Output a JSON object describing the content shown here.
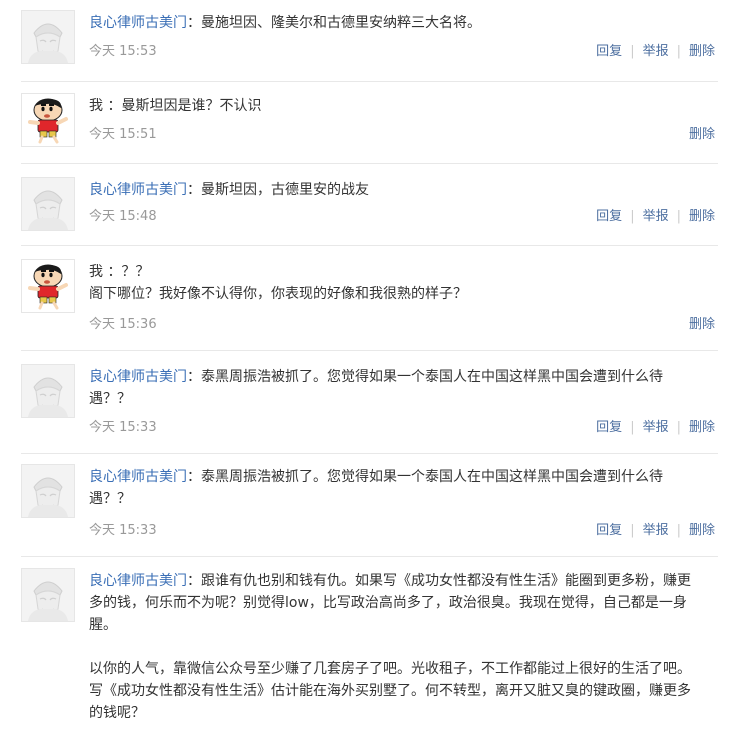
{
  "comments": [
    {
      "author": "良心律师古美门",
      "kind": "lawyer",
      "lines": [
        "：曼施坦因、隆美尔和古德里安纳粹三大名将。"
      ],
      "time": "今天 15:53",
      "actions": [
        "回复",
        "举报",
        "删除"
      ]
    },
    {
      "author": "",
      "kind": "shinchan",
      "lines": [
        "我 ：曼斯坦因是谁？不认识"
      ],
      "time": "今天 15:51",
      "actions": [
        "删除"
      ]
    },
    {
      "author": "良心律师古美门",
      "kind": "lawyer",
      "lines": [
        "：曼斯坦因，古德里安的战友"
      ],
      "time": "今天 15:48",
      "actions": [
        "回复",
        "举报",
        "删除"
      ]
    },
    {
      "author": "",
      "kind": "shinchan",
      "lines": [
        "我 ：？？",
        "阁下哪位？我好像不认得你，你表现的好像和我很熟的样子？"
      ],
      "time": "今天 15:36",
      "actions": [
        "删除"
      ]
    },
    {
      "author": "良心律师古美门",
      "kind": "lawyer",
      "lines": [
        "：泰黑周振浩被抓了。您觉得如果一个泰国人在中国这样黑中国会遭到什么待",
        "遇？？"
      ],
      "time": "今天 15:33",
      "actions": [
        "回复",
        "举报",
        "删除"
      ]
    },
    {
      "author": "良心律师古美门",
      "kind": "lawyer",
      "lines": [
        "：泰黑周振浩被抓了。您觉得如果一个泰国人在中国这样黑中国会遭到什么待",
        "遇？？"
      ],
      "time": "今天 15:33",
      "actions": [
        "回复",
        "举报",
        "删除"
      ]
    },
    {
      "author": "良心律师古美门",
      "kind": "lawyer",
      "lines": [
        "：跟谁有仇也别和钱有仇。如果写《成功女性都没有性生活》能圈到更多粉，赚更",
        "多的钱，何乐而不为呢？别觉得low，比写政治高尚多了，政治很臭。我现在觉得，自己都是一身",
        "腥。",
        "",
        "以你的人气，靠微信公众号至少赚了几套房子了吧。光收租子，不工作都能过上很好的生活了吧。",
        "写《成功女性都没有性生活》估计能在海外买别墅了。何不转型，离开又脏又臭的键政圈，赚更多",
        "的钱呢？"
      ],
      "time": "",
      "actions": []
    }
  ]
}
